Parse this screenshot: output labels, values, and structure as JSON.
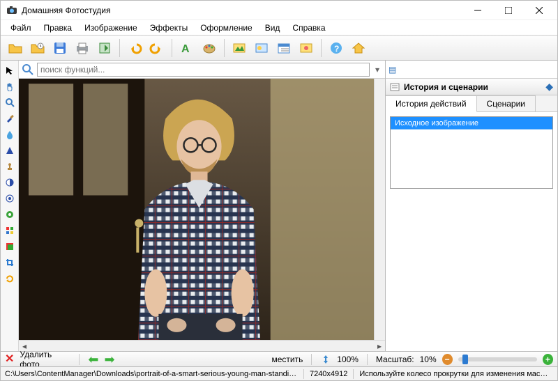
{
  "app": {
    "title": "Домашняя Фотостудия"
  },
  "menu": [
    "Файл",
    "Правка",
    "Изображение",
    "Эффекты",
    "Оформление",
    "Вид",
    "Справка"
  ],
  "toolbar": {
    "items": [
      "open",
      "open-recent",
      "save",
      "print",
      "export",
      "|",
      "undo",
      "redo",
      "|",
      "text",
      "brush",
      "|",
      "img1",
      "img2",
      "img3",
      "img4",
      "|",
      "help",
      "home"
    ]
  },
  "search": {
    "placeholder": "поиск функций..."
  },
  "history_panel": {
    "title": "История и сценарии",
    "tabs": {
      "history": "История действий",
      "scenarios": "Сценарии"
    },
    "items": [
      "Исходное изображение"
    ]
  },
  "tools_left": [
    "pointer",
    "hand",
    "zoom",
    "brush",
    "teardrop",
    "blur",
    "stamp",
    "contrast",
    "sharp",
    "color",
    "rgb",
    "cmyk",
    "crop",
    "rotate"
  ],
  "bottom": {
    "delete_label": "Удалить фото",
    "fit_label": "местить",
    "fit_percent": "100%",
    "scale_label": "Масштаб:",
    "scale_value": "10%"
  },
  "footer": {
    "path": "C:\\Users\\ContentManager\\Downloads\\portrait-of-a-smart-serious-young-man-standing-l",
    "dims": "7240x4912",
    "hint": "Используйте колесо прокрутки для изменения масштаба"
  }
}
